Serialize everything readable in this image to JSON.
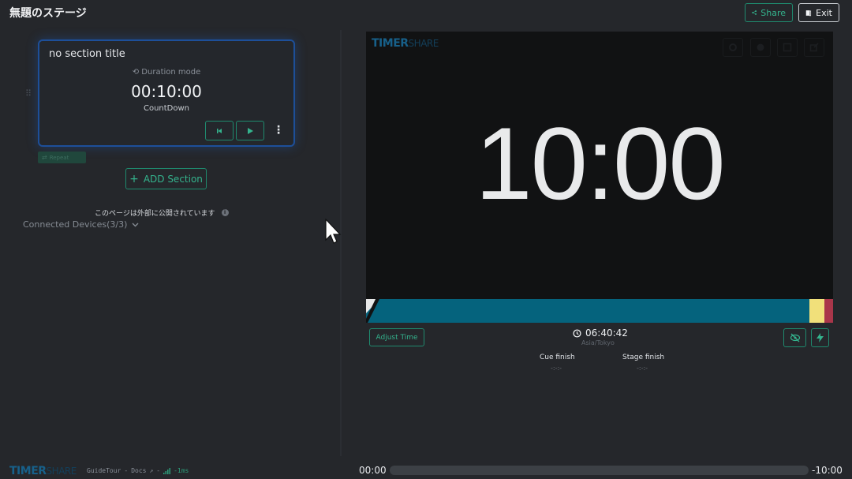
{
  "header": {
    "title": "無題のステージ",
    "share_label": "Share",
    "exit_label": "Exit"
  },
  "section_card": {
    "title": "no section title",
    "mode_label": "Duration mode",
    "time": "00:10:00",
    "type": "CountDown",
    "repeat_label": "Repeat"
  },
  "left_panel": {
    "add_section_label": "ADD Section",
    "public_notice": "このページは外部に公開されています",
    "devices_label": "Connected Devices(3/3)"
  },
  "preview": {
    "logo_main": "TIMER",
    "logo_sub": "SHARE",
    "display_time": "10:00",
    "progress_colors": {
      "main": "#05637d",
      "warning": "#f1e07a",
      "danger": "#a9364a",
      "elapsed": "#e8e8e8"
    }
  },
  "controls": {
    "adjust_label": "Adjust Time",
    "clock_time": "06:40:42",
    "timezone": "Asia/Tokyo",
    "cue_finish_label": "Cue finish",
    "cue_finish_value": "-:-:-",
    "stage_finish_label": "Stage finish",
    "stage_finish_value": "-:-:-"
  },
  "footer": {
    "logo_main": "TIMER",
    "logo_sub": "SHARE",
    "guide_tour": "GuideTour",
    "docs": "Docs",
    "latency": "-1ms",
    "time_start": "00:00",
    "time_end": "-10:00"
  }
}
